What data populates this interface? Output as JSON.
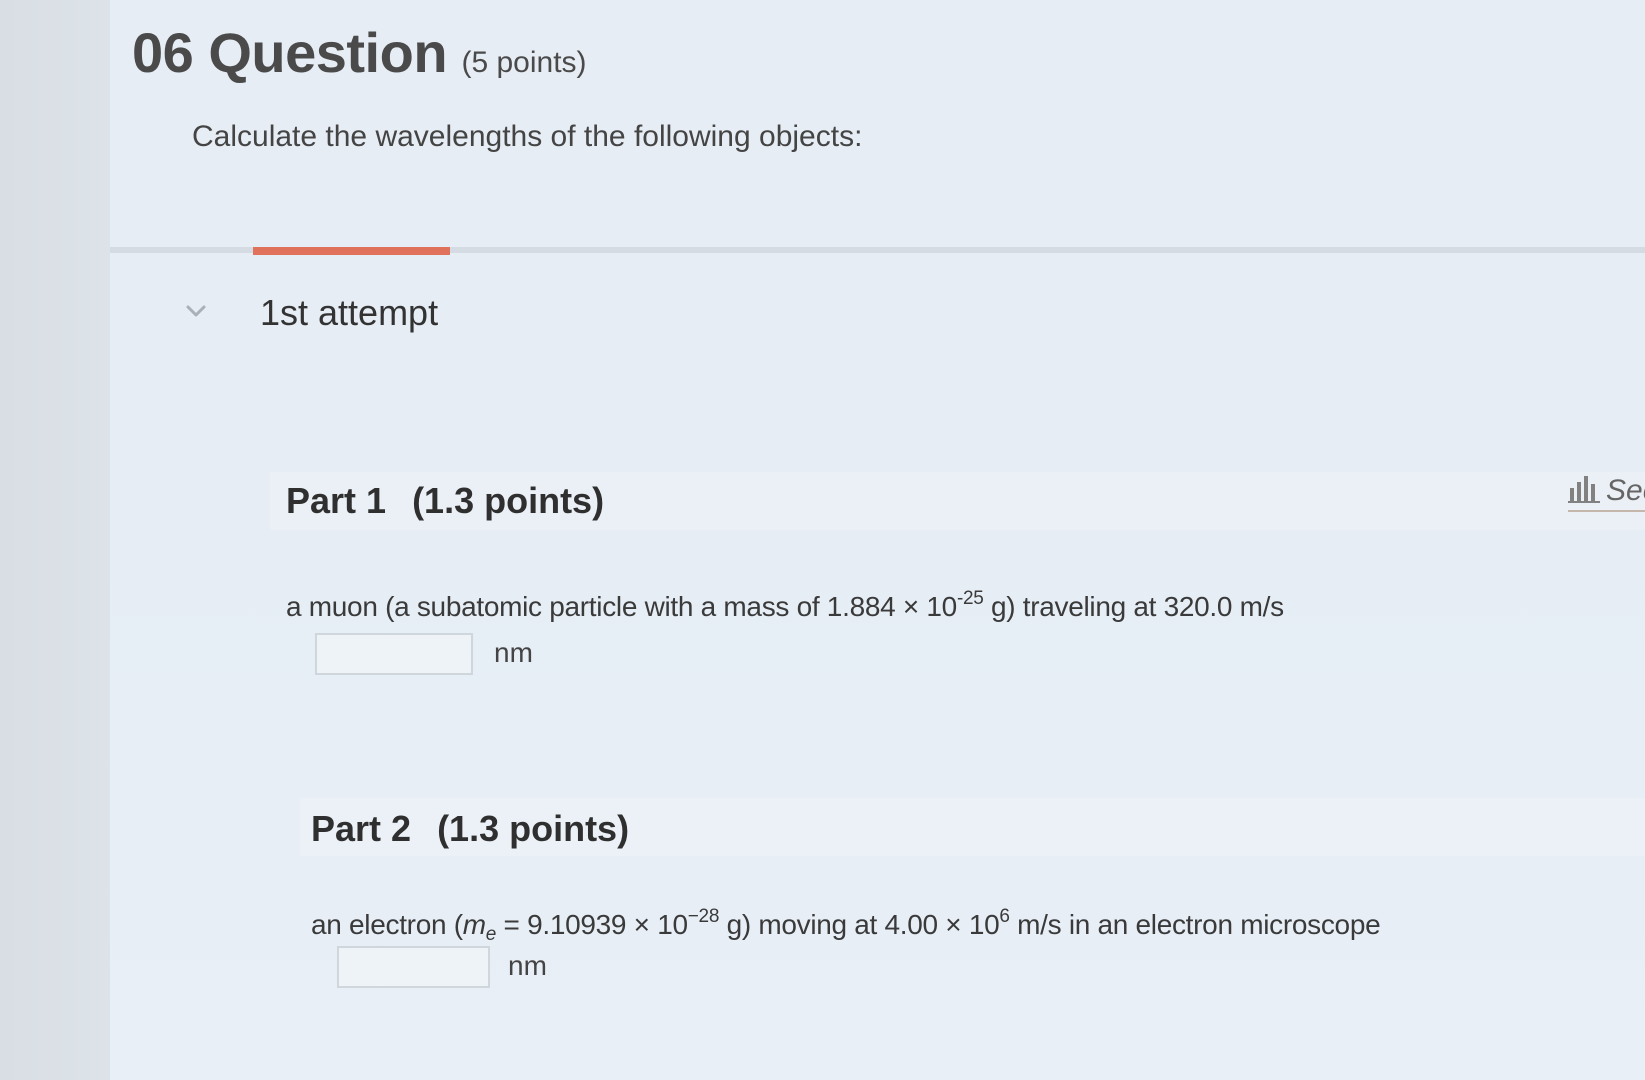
{
  "question": {
    "number_title": "06 Question",
    "points": "(5 points)",
    "prompt": "Calculate the wavelengths of the following objects:"
  },
  "attempt": {
    "label": "1st attempt"
  },
  "side_link": {
    "label": "See",
    "icon": "bar-chart-icon"
  },
  "parts": [
    {
      "title": "Part 1",
      "points": "(1.3 points)",
      "text_pre": "a muon (a subatomic particle with a mass of 1.884 × 10",
      "exponent": "-25",
      "text_post": " g) traveling at 320.0 m/s",
      "input_value": "",
      "unit": "nm"
    },
    {
      "title": "Part 2",
      "points": "(1.3 points)",
      "text_pre": "an electron (",
      "symbol": "m",
      "subscript": "e",
      "text_mid": " = 9.10939 × 10",
      "exponent": "−28",
      "text_mid2": " g) moving at 4.00 × 10",
      "exponent2": "6",
      "text_post": " m/s in an electron microscope",
      "input_value": "",
      "unit": "nm"
    }
  ],
  "colors": {
    "accent_underline": "#e0715a",
    "background": "#e6edf5"
  }
}
